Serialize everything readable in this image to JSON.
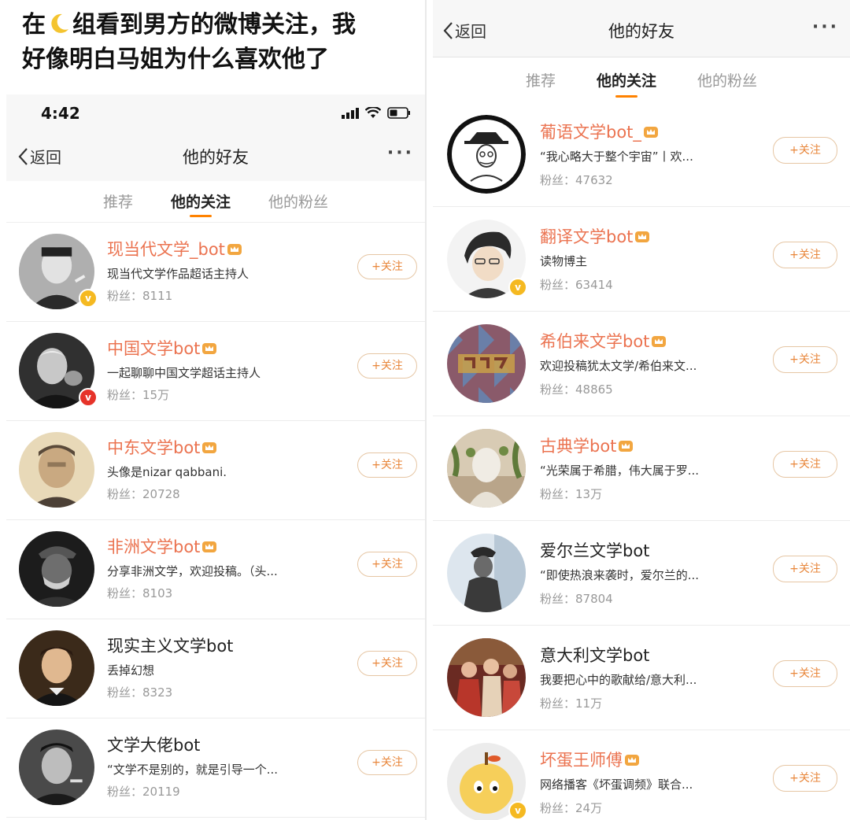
{
  "caption": {
    "line1_before": "在",
    "line1_after": "组看到男方的微博关注，我",
    "line2": "好像明白马姐为什么喜欢他了",
    "moon_icon": "crescent-moon-icon"
  },
  "status_bar": {
    "time": "4:42"
  },
  "nav": {
    "back_label": "返回",
    "title": "他的好友",
    "more_label": "···"
  },
  "tabs": [
    "推荐",
    "他的关注",
    "他的粉丝"
  ],
  "active_tab": "他的关注",
  "follow_label": "+关注",
  "colors": {
    "accent": "#ff8200",
    "vip_name": "#eb7350",
    "follow_border": "#e6c6a4",
    "verified_yellow": "#f5b921",
    "verified_red": "#e6332a"
  },
  "left_list": [
    {
      "name": "现当代文学_bot",
      "desc": "现当代文学作品超话主持人",
      "fans": "粉丝：8111"
    },
    {
      "name": "中国文学bot",
      "desc": "一起聊聊中国文学超话主持人",
      "fans": "粉丝：15万"
    },
    {
      "name": "中东文学bot",
      "desc": "头像是nizar qabbani.",
      "fans": "粉丝：20728"
    },
    {
      "name": "非洲文学bot",
      "desc": "分享非洲文学，欢迎投稿。（头...",
      "fans": "粉丝：8103"
    },
    {
      "name": "现实主义文学bot",
      "desc": "丢掉幻想",
      "fans": "粉丝：8323"
    },
    {
      "name": "文学大佬bot",
      "desc": "“文学不是别的，就是引导一个...",
      "fans": "粉丝：20119"
    }
  ],
  "right_list": [
    {
      "name": "葡语文学bot_",
      "desc": "“我心略大于整个宇宙”丨欢...",
      "fans": "粉丝：47632"
    },
    {
      "name": "翻译文学bot",
      "desc": "读物博主",
      "fans": "粉丝：63414"
    },
    {
      "name": "希伯来文学bot",
      "desc": "欢迎投稿犹太文学/希伯来文...",
      "fans": "粉丝：48865"
    },
    {
      "name": "古典学bot",
      "desc": "“光荣属于希腊，伟大属于罗...",
      "fans": "粉丝：13万"
    },
    {
      "name": "爱尔兰文学bot",
      "desc": "“即使热浪来袭时，爱尔兰的...",
      "fans": "粉丝：87804"
    },
    {
      "name": "意大利文学bot",
      "desc": "我要把心中的歌献给/意大利...",
      "fans": "粉丝：11万"
    },
    {
      "name": "坏蛋王师傅",
      "desc": "网络播客《坏蛋调频》联合...",
      "fans": "粉丝：24万"
    }
  ]
}
